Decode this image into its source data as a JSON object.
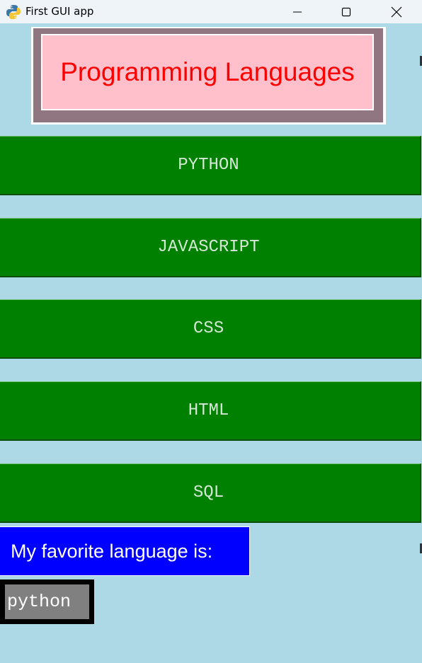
{
  "window": {
    "title": "First GUI app",
    "icon": "python-icon"
  },
  "header": {
    "text": "Programming Languages"
  },
  "languages": [
    "PYTHON",
    "JAVASCRIPT",
    "CSS",
    "HTML",
    "SQL"
  ],
  "favorite": {
    "label": "My favorite language is:",
    "value": "python"
  },
  "colors": {
    "background": "#add8e6",
    "header_bg": "#ffc0cb",
    "header_text": "#ff0000",
    "button_bg": "#008000",
    "label_bg": "#0000ff",
    "entry_bg": "#808080"
  }
}
